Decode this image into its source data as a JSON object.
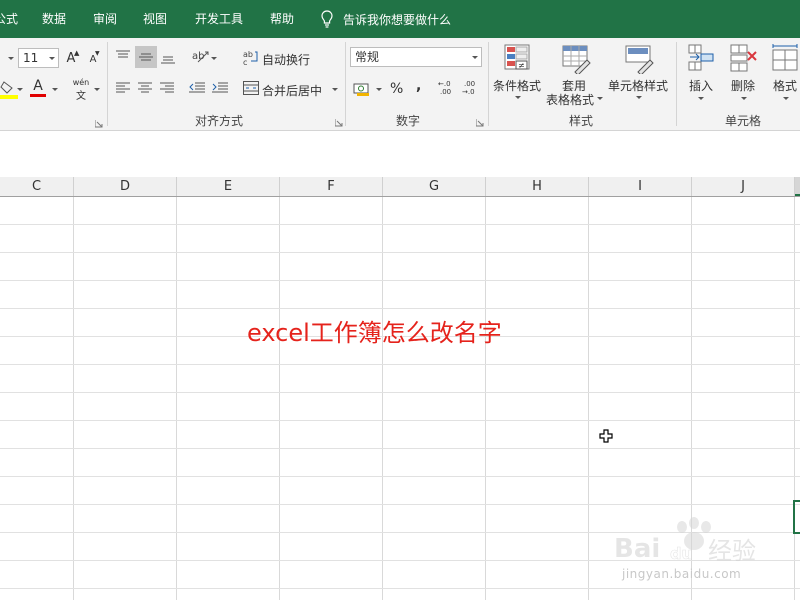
{
  "menu": {
    "items": [
      "公式",
      "数据",
      "审阅",
      "视图",
      "开发工具",
      "帮助"
    ],
    "tell_me": "告诉我你想要做什么"
  },
  "font": {
    "size": "11",
    "grow_icon": "A",
    "shrink_icon": "A",
    "font_color_letter": "A",
    "phonetic_top": "wén",
    "phonetic_bottom": "文"
  },
  "alignment": {
    "wrap_text": "自动换行",
    "merge_center": "合并后居中",
    "group_label": "对齐方式"
  },
  "number": {
    "format_value": "常规",
    "percent": "%",
    "comma": ",",
    "group_label": "数字",
    "inc_decimal_top": "←.0",
    "inc_decimal_bottom": ".00",
    "dec_decimal_top": ".00",
    "dec_decimal_bottom": "→.0"
  },
  "styles": {
    "conditional": "条件格式",
    "table_line1": "套用",
    "table_line2": "表格格式",
    "cell_styles": "单元格样式",
    "group_label": "样式"
  },
  "cells": {
    "insert": "插入",
    "delete": "删除",
    "format": "格式",
    "group_label": "单元格"
  },
  "sheet": {
    "columns": [
      "C",
      "D",
      "E",
      "F",
      "G",
      "H",
      "I",
      "J"
    ],
    "overlay_text": "excel工作簿怎么改名字"
  },
  "watermark": {
    "logo_text": "Bai du 经验",
    "url": "jingyan.baidu.com"
  },
  "colors": {
    "excel_green": "#217346",
    "overlay_red": "#e5231c",
    "font_color_bar": "#e00000",
    "highlight_bar": "#ffff00"
  }
}
